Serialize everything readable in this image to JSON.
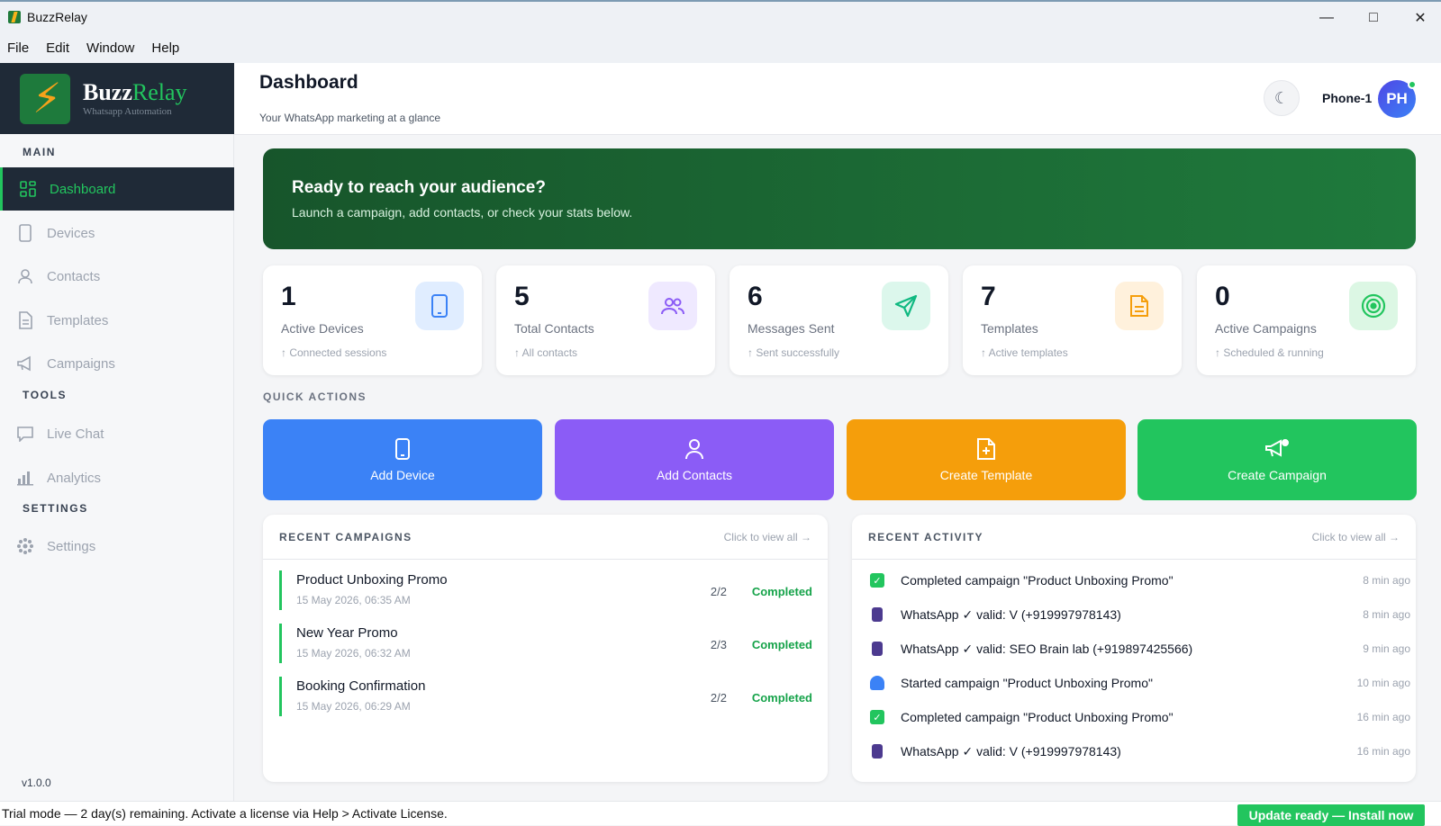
{
  "window": {
    "title": "BuzzRelay"
  },
  "menu": [
    "File",
    "Edit",
    "Window",
    "Help"
  ],
  "brand": {
    "name_a": "Buzz",
    "name_b": "Relay",
    "tagline": "Whatsapp Automation"
  },
  "sidebar": {
    "sections": {
      "main": "MAIN",
      "tools": "TOOLS",
      "settings": "SETTINGS"
    },
    "items": [
      {
        "label": "Dashboard",
        "icon": "grid-icon"
      },
      {
        "label": "Devices",
        "icon": "phone-icon"
      },
      {
        "label": "Contacts",
        "icon": "user-icon"
      },
      {
        "label": "Templates",
        "icon": "document-icon"
      },
      {
        "label": "Campaigns",
        "icon": "megaphone-icon"
      },
      {
        "label": "Live Chat",
        "icon": "chat-icon"
      },
      {
        "label": "Analytics",
        "icon": "bar-chart-icon"
      },
      {
        "label": "Settings",
        "icon": "gear-icon"
      }
    ],
    "version": "v1.0.0"
  },
  "header": {
    "title": "Dashboard",
    "subtitle": "Your WhatsApp marketing at a glance",
    "device": "Phone-1",
    "avatar": "PH"
  },
  "hero": {
    "title": "Ready to reach your audience?",
    "subtitle": "Launch a campaign, add contacts, or check your stats below."
  },
  "stats": [
    {
      "value": "1",
      "label": "Active Devices",
      "hint": "↑ Connected sessions",
      "color": "#3b82f6",
      "bg": "#e0edff",
      "icon": "phone-icon"
    },
    {
      "value": "5",
      "label": "Total Contacts",
      "hint": "↑ All contacts",
      "color": "#8b5cf6",
      "bg": "#efe9ff",
      "icon": "users-icon"
    },
    {
      "value": "6",
      "label": "Messages Sent",
      "hint": "↑ Sent successfully",
      "color": "#10b981",
      "bg": "#dcf7ec",
      "icon": "send-icon"
    },
    {
      "value": "7",
      "label": "Templates",
      "hint": "↑ Active templates",
      "color": "#f59e0b",
      "bg": "#fff1dc",
      "icon": "document-icon"
    },
    {
      "value": "0",
      "label": "Active Campaigns",
      "hint": "↑ Scheduled & running",
      "color": "#22c55e",
      "bg": "#dcf7e4",
      "icon": "target-icon"
    }
  ],
  "quick_actions": {
    "title": "QUICK ACTIONS",
    "items": [
      {
        "label": "Add Device",
        "color": "#3b82f6",
        "icon": "phone-icon"
      },
      {
        "label": "Add Contacts",
        "color": "#8b5cf6",
        "icon": "user-icon"
      },
      {
        "label": "Create Template",
        "color": "#f59e0b",
        "icon": "file-plus-icon"
      },
      {
        "label": "Create Campaign",
        "color": "#22c55e",
        "icon": "megaphone-icon"
      }
    ]
  },
  "recent_campaigns": {
    "title": "RECENT CAMPAIGNS",
    "view_all": "Click to view all →",
    "items": [
      {
        "name": "Product Unboxing Promo",
        "date": "15 May 2026, 06:35 AM",
        "count": "2/2",
        "status": "Completed"
      },
      {
        "name": "New Year Promo",
        "date": "15 May 2026, 06:32 AM",
        "count": "2/3",
        "status": "Completed"
      },
      {
        "name": "Booking Confirmation",
        "date": "15 May 2026, 06:29 AM",
        "count": "2/2",
        "status": "Completed"
      }
    ]
  },
  "recent_activity": {
    "title": "RECENT ACTIVITY",
    "view_all": "Click to view all →",
    "items": [
      {
        "text": "Completed campaign \"Product Unboxing Promo\"",
        "time": "8 min ago",
        "icon": "check-box-icon",
        "color": "#22c55e"
      },
      {
        "text": "WhatsApp ✓ valid: V (+919997978143)",
        "time": "8 min ago",
        "icon": "phone-icon",
        "color": "#4c3a8f"
      },
      {
        "text": "WhatsApp ✓ valid: SEO Brain lab (+919897425566)",
        "time": "9 min ago",
        "icon": "phone-icon",
        "color": "#4c3a8f"
      },
      {
        "text": "Started campaign \"Product Unboxing Promo\"",
        "time": "10 min ago",
        "icon": "rocket-icon",
        "color": "#3b82f6"
      },
      {
        "text": "Completed campaign \"Product Unboxing Promo\"",
        "time": "16 min ago",
        "icon": "check-box-icon",
        "color": "#22c55e"
      },
      {
        "text": "WhatsApp ✓ valid: V (+919997978143)",
        "time": "16 min ago",
        "icon": "phone-icon",
        "color": "#4c3a8f"
      }
    ]
  },
  "status_bar": {
    "trial": "Trial mode — 2 day(s) remaining. Activate a license via Help > Activate License.",
    "update": "Update ready — Install now"
  }
}
